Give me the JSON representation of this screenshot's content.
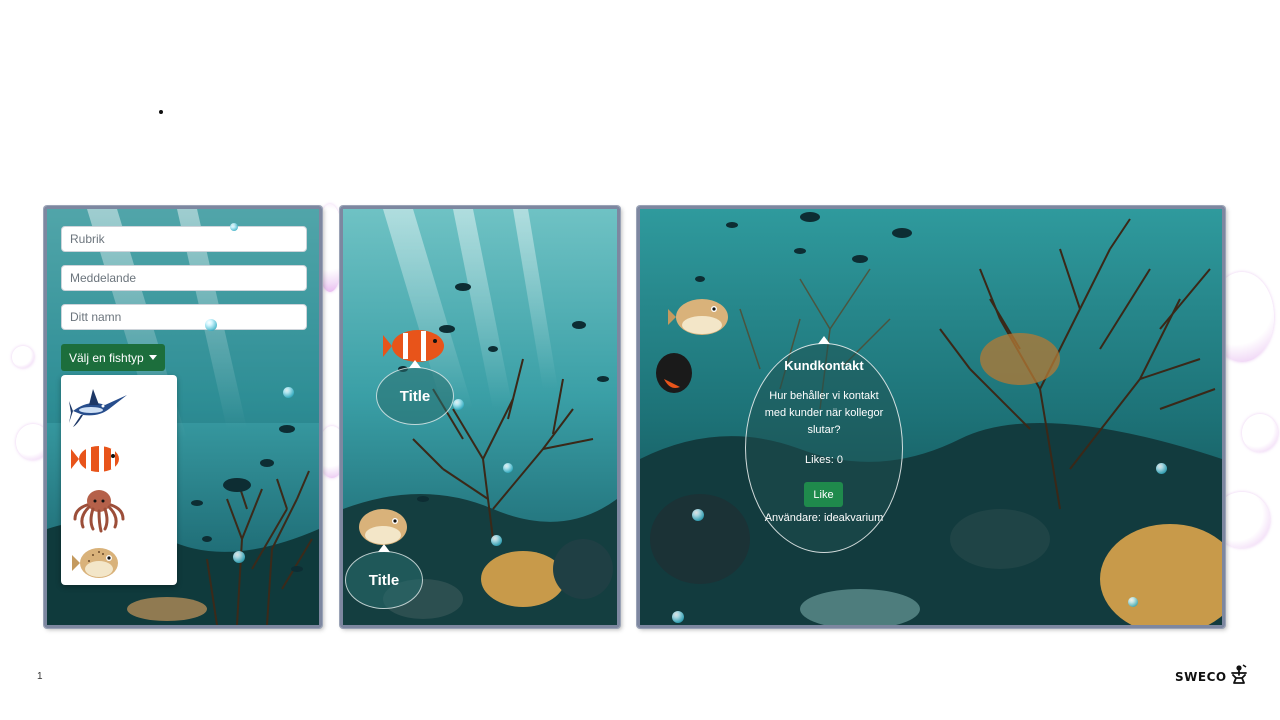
{
  "slide": {
    "page_number": "1"
  },
  "logo": {
    "text": "SWECO",
    "icon": "sweco-person-icon"
  },
  "form": {
    "title_placeholder": "Rubrik",
    "message_placeholder": "Meddelande",
    "name_placeholder": "Ditt namn",
    "dropdown_label": "Välj en fishtyp",
    "fish_options": [
      "swordfish-icon",
      "clownfish-icon",
      "octopus-icon",
      "pufferfish-icon"
    ]
  },
  "aquarium_middle": {
    "bubbles": [
      {
        "title": "Title"
      },
      {
        "title": "Title"
      }
    ]
  },
  "aquarium_right": {
    "idea": {
      "title": "Kundkontakt",
      "message": "Hur behåller vi kontakt med kunder när kollegor slutar?",
      "likes": "Likes: 0",
      "like_button": "Like",
      "user": "Användare: ideakvarium"
    }
  },
  "colors": {
    "dropdown_green": "#1c6e3c",
    "like_green": "#1f8a4c",
    "panel_border": "#7d87a0",
    "water": "#2a9aa0"
  }
}
